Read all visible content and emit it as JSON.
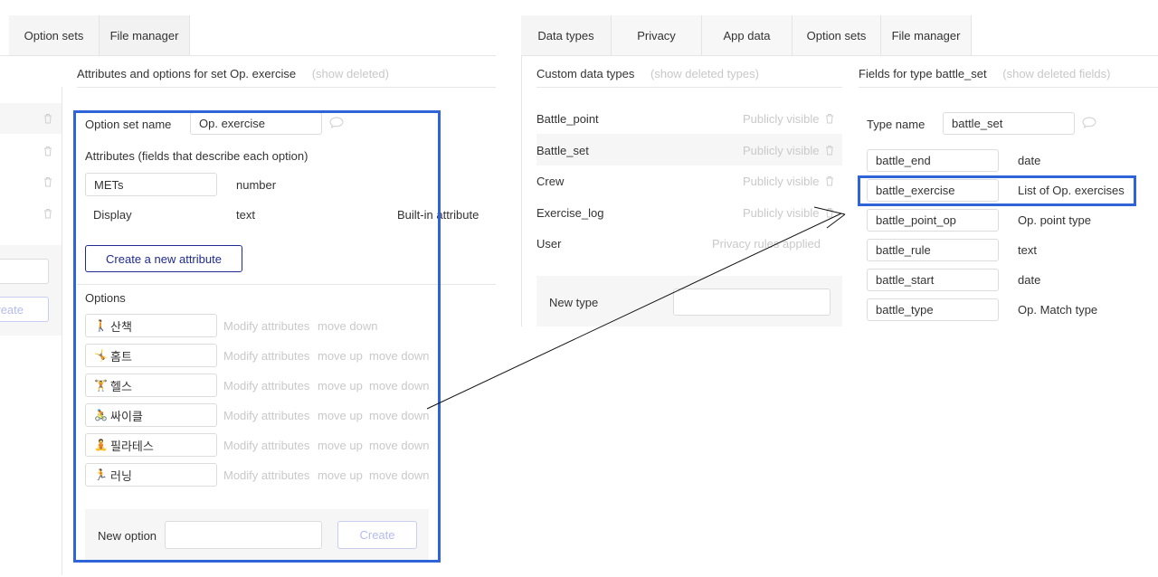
{
  "left_panel": {
    "tabs": [
      {
        "label": "Option sets"
      },
      {
        "label": "File manager"
      }
    ],
    "heading": "Attributes and options for set Op. exercise",
    "show_deleted": "(show deleted)",
    "partial_create_label": "reate",
    "option_set_name_label": "Option set name",
    "option_set_name_value": "Op. exercise",
    "attributes_heading": "Attributes (fields that describe each option)",
    "attributes": [
      {
        "name": "METs",
        "type": "number",
        "note": ""
      },
      {
        "name": "Display",
        "type": "text",
        "note": "Built-in attribute"
      }
    ],
    "create_attribute_label": "Create a new attribute",
    "options_heading": "Options",
    "options": [
      {
        "emoji": "🚶",
        "label": "산책",
        "modify": "Modify attributes",
        "move_up": "",
        "move_down": "move down"
      },
      {
        "emoji": "🤸",
        "label": "홈트",
        "modify": "Modify attributes",
        "move_up": "move up",
        "move_down": "move down"
      },
      {
        "emoji": "🏋",
        "label": "헬스",
        "modify": "Modify attributes",
        "move_up": "move up",
        "move_down": "move down"
      },
      {
        "emoji": "🚴",
        "label": "싸이클",
        "modify": "Modify attributes",
        "move_up": "move up",
        "move_down": "move down"
      },
      {
        "emoji": "🧘",
        "label": "필라테스",
        "modify": "Modify attributes",
        "move_up": "move up",
        "move_down": "move down"
      },
      {
        "emoji": "🏃",
        "label": "러닝",
        "modify": "Modify attributes",
        "move_up": "move up",
        "move_down": "move down"
      }
    ],
    "new_option_label": "New option",
    "new_option_value": "",
    "create_label": "Create"
  },
  "right_panel": {
    "tabs": [
      {
        "label": "Data types"
      },
      {
        "label": "Privacy"
      },
      {
        "label": "App data"
      },
      {
        "label": "Option sets"
      },
      {
        "label": "File manager"
      }
    ],
    "custom_types_heading": "Custom data types",
    "show_deleted_types": "(show deleted types)",
    "types": [
      {
        "name": "Battle_point",
        "status": "Publicly visible"
      },
      {
        "name": "Battle_set",
        "status": "Publicly visible"
      },
      {
        "name": "Crew",
        "status": "Publicly visible"
      },
      {
        "name": "Exercise_log",
        "status": "Publicly visible"
      },
      {
        "name": "User",
        "status": "Privacy rules applied"
      }
    ],
    "new_type_label": "New type",
    "new_type_value": "",
    "fields_heading": "Fields for type battle_set",
    "show_deleted_fields": "(show deleted fields)",
    "type_name_label": "Type name",
    "type_name_value": "battle_set",
    "fields": [
      {
        "name": "battle_end",
        "type": "date"
      },
      {
        "name": "battle_exercise",
        "type": "List of Op. exercises"
      },
      {
        "name": "battle_point_op",
        "type": "Op. point type"
      },
      {
        "name": "battle_rule",
        "type": "text"
      },
      {
        "name": "battle_start",
        "type": "date"
      },
      {
        "name": "battle_type",
        "type": "Op. Match type"
      }
    ]
  },
  "colors": {
    "highlight": "#2f63d8",
    "button_border": "#1f2b8f"
  }
}
